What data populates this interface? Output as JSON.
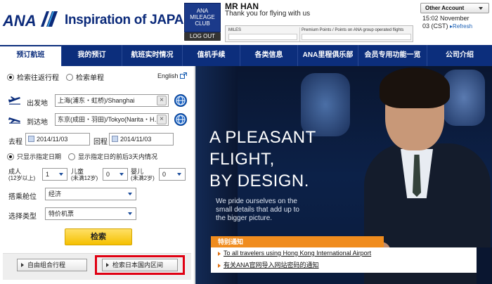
{
  "header": {
    "logo": "ANA",
    "tagline": "Inspiration of JAPAN",
    "amc_lines": [
      "ANA",
      "MILEAGE",
      "CLUB"
    ],
    "logout": "LOG OUT",
    "user_name": "MR HAN",
    "greeting": "Thank you for flying with us",
    "miles_label": "MILES",
    "premium_label": "Premium Points / Points on ANA group operated flights",
    "other_account": "Other Account",
    "time_line1": "15:02 November",
    "time_line2": "03 (CST)",
    "refresh": "Refresh"
  },
  "nav": {
    "items": [
      {
        "label": "预订航班",
        "active": true
      },
      {
        "label": "我的预订",
        "active": false
      },
      {
        "label": "航班实时情况",
        "active": false
      },
      {
        "label": "值机手续",
        "active": false
      },
      {
        "label": "各类信息",
        "active": false
      },
      {
        "label": "ANA里程俱乐部",
        "active": false
      },
      {
        "label": "会员专用功能一览",
        "active": false
      },
      {
        "label": "公司介绍",
        "active": false
      }
    ]
  },
  "booking": {
    "trip_round": "检索往返行程",
    "trip_oneway": "检索单程",
    "english": "English",
    "from_label": "出发地",
    "from_value": "上海(浦东・虹桥)/Shanghai",
    "to_label": "到达地",
    "to_value": "东京(成田・羽田)/Tokyo(Narita・H…",
    "depart_label": "去程",
    "depart_date": "2014/11/03",
    "return_label": "回程",
    "return_date": "2014/11/03",
    "date_exact": "只显示指定日期",
    "date_range": "显示指定日的前后3天内情况",
    "adult_label": "成人",
    "adult_sub": "(12岁以上)",
    "adult_value": "1",
    "child_label": "儿童",
    "child_sub": "(未满12岁)",
    "child_value": "0",
    "infant_label": "婴儿",
    "infant_sub": "(未满2岁)",
    "infant_value": "0",
    "cabin_label": "搭乘舱位",
    "cabin_value": "经济",
    "type_label": "选择类型",
    "type_value": "特价机票",
    "search_button": "检索",
    "custom_itinerary": "自由组合行程",
    "domestic_search": "检索日本国内区间"
  },
  "hero": {
    "title_lines": [
      "A PLEASANT",
      "FLIGHT,",
      "BY DESIGN."
    ],
    "sub_lines": [
      "We pride ourselves on the",
      "small details that add up to",
      "the bigger picture."
    ],
    "notice_title": "特别通知",
    "notice_links": [
      "To all travelers using Hong Kong International Airport",
      "有关ANA官网导入网站密码的通知"
    ]
  },
  "colors": {
    "brand_navy": "#0c2e7c",
    "accent_yellow": "#f5c000",
    "notice_orange": "#f08c1e",
    "highlight_red": "#e00012"
  }
}
